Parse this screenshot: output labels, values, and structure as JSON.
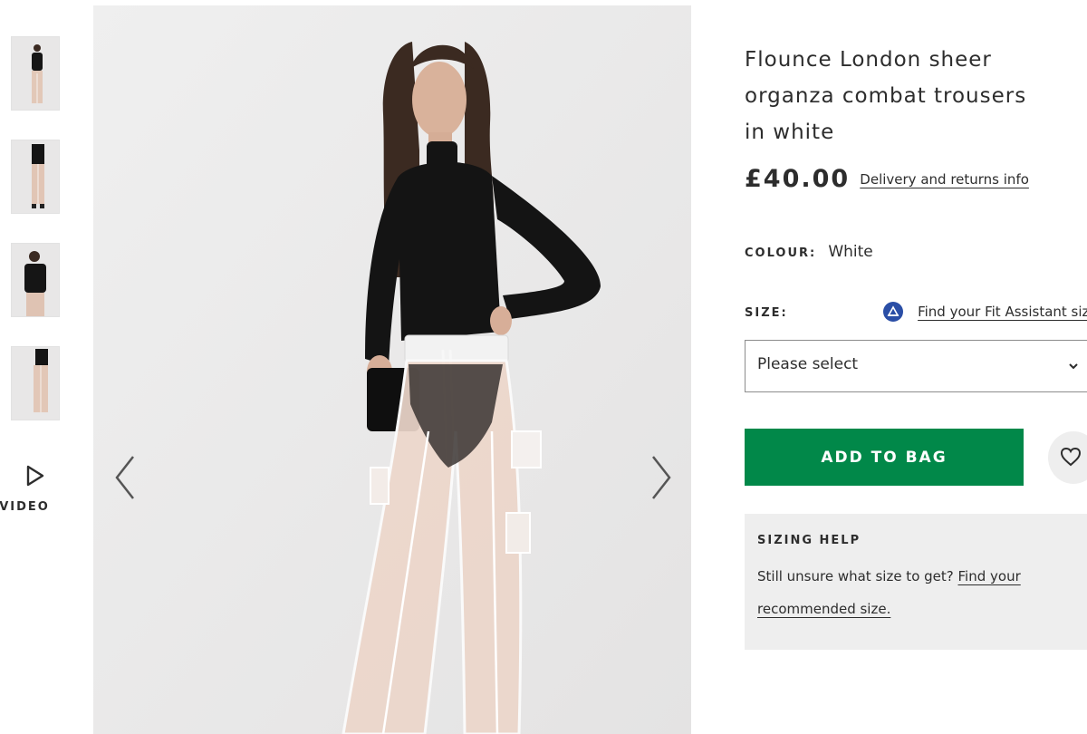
{
  "gallery": {
    "thumbnails": [
      {
        "alt": "product-view-1"
      },
      {
        "alt": "product-view-2"
      },
      {
        "alt": "product-view-3"
      },
      {
        "alt": "product-view-4"
      }
    ],
    "video_label": "VIDEO",
    "video_icon": "play-icon",
    "prev_icon": "chevron-left-icon",
    "next_icon": "chevron-right-icon"
  },
  "product": {
    "title": "Flounce London sheer organza combat trousers in white",
    "price": "£40.00",
    "delivery_link": "Delivery and returns info",
    "colour_label": "COLOUR:",
    "colour_value": "White",
    "size_label": "SIZE:",
    "fit_assistant_icon": "fit-assistant-icon",
    "fit_assistant_link": "Find your Fit Assistant size",
    "size_select": {
      "selected": "Please select",
      "icon": "chevron-down-icon"
    },
    "add_to_bag": "ADD TO BAG",
    "wishlist_icon": "heart-icon"
  },
  "sizing_help": {
    "heading": "SIZING HELP",
    "text": "Still unsure what size to get?",
    "link": "Find your recommended size."
  },
  "colors": {
    "accent_green": "#018849",
    "text": "#2d2d2d",
    "panel_bg": "#eeeeee",
    "fit_icon_blue": "#2a4ea6"
  }
}
